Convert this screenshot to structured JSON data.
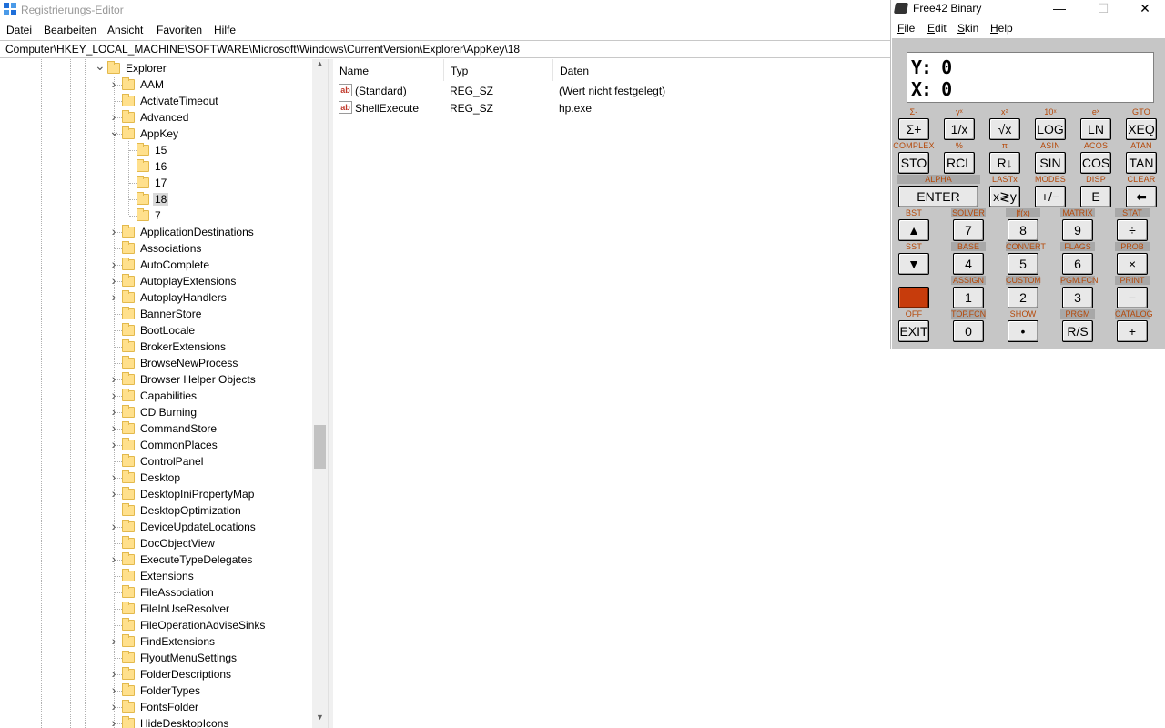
{
  "regedit": {
    "title": "Registrierungs-Editor",
    "menu": [
      {
        "ul": "D",
        "rest": "atei"
      },
      {
        "ul": "B",
        "rest": "earbeiten"
      },
      {
        "ul": "A",
        "rest": "nsicht"
      },
      {
        "ul": "F",
        "rest": "avoriten"
      },
      {
        "ul": "H",
        "rest": "ilfe"
      }
    ],
    "address": "Computer\\HKEY_LOCAL_MACHINE\\SOFTWARE\\Microsoft\\Windows\\CurrentVersion\\Explorer\\AppKey\\18",
    "tree": [
      {
        "label": "Explorer",
        "expander": "v",
        "depth": 0
      },
      {
        "label": "AAM",
        "expander": ">",
        "depth": 1
      },
      {
        "label": "ActivateTimeout",
        "expander": "",
        "depth": 1
      },
      {
        "label": "Advanced",
        "expander": ">",
        "depth": 1
      },
      {
        "label": "AppKey",
        "expander": "v",
        "depth": 1
      },
      {
        "label": "15",
        "expander": "",
        "depth": 2
      },
      {
        "label": "16",
        "expander": "",
        "depth": 2
      },
      {
        "label": "17",
        "expander": "",
        "depth": 2
      },
      {
        "label": "18",
        "expander": "",
        "depth": 2,
        "selected": true
      },
      {
        "label": "7",
        "expander": "",
        "depth": 2
      },
      {
        "label": "ApplicationDestinations",
        "expander": ">",
        "depth": 1
      },
      {
        "label": "Associations",
        "expander": "",
        "depth": 1
      },
      {
        "label": "AutoComplete",
        "expander": ">",
        "depth": 1
      },
      {
        "label": "AutoplayExtensions",
        "expander": ">",
        "depth": 1
      },
      {
        "label": "AutoplayHandlers",
        "expander": ">",
        "depth": 1
      },
      {
        "label": "BannerStore",
        "expander": "",
        "depth": 1
      },
      {
        "label": "BootLocale",
        "expander": "",
        "depth": 1
      },
      {
        "label": "BrokerExtensions",
        "expander": "",
        "depth": 1
      },
      {
        "label": "BrowseNewProcess",
        "expander": "",
        "depth": 1
      },
      {
        "label": "Browser Helper Objects",
        "expander": ">",
        "depth": 1
      },
      {
        "label": "Capabilities",
        "expander": ">",
        "depth": 1
      },
      {
        "label": "CD Burning",
        "expander": ">",
        "depth": 1
      },
      {
        "label": "CommandStore",
        "expander": ">",
        "depth": 1
      },
      {
        "label": "CommonPlaces",
        "expander": ">",
        "depth": 1
      },
      {
        "label": "ControlPanel",
        "expander": "",
        "depth": 1
      },
      {
        "label": "Desktop",
        "expander": ">",
        "depth": 1
      },
      {
        "label": "DesktopIniPropertyMap",
        "expander": ">",
        "depth": 1
      },
      {
        "label": "DesktopOptimization",
        "expander": "",
        "depth": 1
      },
      {
        "label": "DeviceUpdateLocations",
        "expander": ">",
        "depth": 1
      },
      {
        "label": "DocObjectView",
        "expander": "",
        "depth": 1
      },
      {
        "label": "ExecuteTypeDelegates",
        "expander": ">",
        "depth": 1
      },
      {
        "label": "Extensions",
        "expander": "",
        "depth": 1
      },
      {
        "label": "FileAssociation",
        "expander": "",
        "depth": 1
      },
      {
        "label": "FileInUseResolver",
        "expander": "",
        "depth": 1
      },
      {
        "label": "FileOperationAdviseSinks",
        "expander": "",
        "depth": 1
      },
      {
        "label": "FindExtensions",
        "expander": ">",
        "depth": 1
      },
      {
        "label": "FlyoutMenuSettings",
        "expander": "",
        "depth": 1
      },
      {
        "label": "FolderDescriptions",
        "expander": ">",
        "depth": 1
      },
      {
        "label": "FolderTypes",
        "expander": ">",
        "depth": 1
      },
      {
        "label": "FontsFolder",
        "expander": ">",
        "depth": 1
      },
      {
        "label": "HideDesktopIcons",
        "expander": ">",
        "depth": 1
      }
    ],
    "columns": [
      "Name",
      "Typ",
      "Daten"
    ],
    "values": [
      {
        "name": "(Standard)",
        "type": "REG_SZ",
        "data": "(Wert nicht festgelegt)"
      },
      {
        "name": "ShellExecute",
        "type": "REG_SZ",
        "data": "hp.exe"
      }
    ]
  },
  "free42": {
    "title": "Free42 Binary",
    "menu": [
      {
        "ul": "F",
        "rest": "ile"
      },
      {
        "ul": "E",
        "rest": "dit"
      },
      {
        "ul": "S",
        "rest": "kin"
      },
      {
        "ul": "H",
        "rest": "elp"
      }
    ],
    "display": {
      "y": "Y: 0",
      "x": "X: 0"
    },
    "keys": [
      {
        "label": "Σ+",
        "shifted": "Σ-"
      },
      {
        "label": "1/x",
        "shifted": "yˣ"
      },
      {
        "label": "√x",
        "shifted": "x²"
      },
      {
        "label": "LOG",
        "shifted": "10ˣ"
      },
      {
        "label": "LN",
        "shifted": "eˣ"
      },
      {
        "label": "XEQ",
        "shifted": "GTO"
      },
      {
        "label": "STO",
        "shifted": "COMPLEX"
      },
      {
        "label": "RCL",
        "shifted": "%"
      },
      {
        "label": "R↓",
        "shifted": "π"
      },
      {
        "label": "SIN",
        "shifted": "ASIN"
      },
      {
        "label": "COS",
        "shifted": "ACOS"
      },
      {
        "label": "TAN",
        "shifted": "ATAN"
      },
      {
        "label": "ENTER",
        "shifted": "ALPHA"
      },
      {
        "label": "x≷y",
        "shifted": "LASTx"
      },
      {
        "label": "+/−",
        "shifted": "MODES"
      },
      {
        "label": "E",
        "shifted": "DISP"
      },
      {
        "label": "⬅",
        "shifted": "CLEAR"
      },
      {
        "label": "▲",
        "shifted": "BST"
      },
      {
        "label": "7",
        "shifted": "SOLVER"
      },
      {
        "label": "8",
        "shifted": "∫f(x)"
      },
      {
        "label": "9",
        "shifted": "MATRIX"
      },
      {
        "label": "÷",
        "shifted": "STAT"
      },
      {
        "label": "▼",
        "shifted": "SST"
      },
      {
        "label": "4",
        "shifted": "BASE"
      },
      {
        "label": "5",
        "shifted": "CONVERT"
      },
      {
        "label": "6",
        "shifted": "FLAGS"
      },
      {
        "label": "×",
        "shifted": "PROB"
      },
      {
        "label": "",
        "shifted": ""
      },
      {
        "label": "1",
        "shifted": "ASSIGN"
      },
      {
        "label": "2",
        "shifted": "CUSTOM"
      },
      {
        "label": "3",
        "shifted": "PGM.FCN"
      },
      {
        "label": "−",
        "shifted": "PRINT"
      },
      {
        "label": "EXIT",
        "shifted": "OFF"
      },
      {
        "label": "0",
        "shifted": "TOP.FCN"
      },
      {
        "label": "•",
        "shifted": "SHOW"
      },
      {
        "label": "R/S",
        "shifted": "PRGM"
      },
      {
        "label": "+",
        "shifted": "CATALOG"
      }
    ],
    "colors": {
      "shift_key": "#c73c0c",
      "shift_label": "#b54808",
      "body": "#c6c6c6"
    }
  }
}
